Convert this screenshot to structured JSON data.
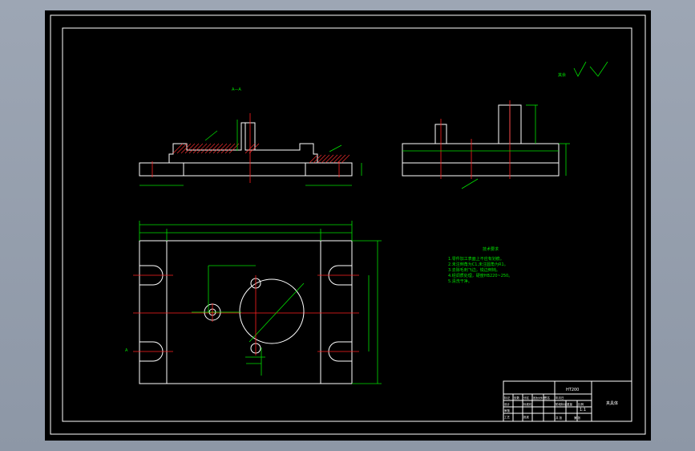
{
  "drawing": {
    "section_label": "A—A",
    "section_marker": "A",
    "roughness_note": "其余",
    "colors": {
      "background": "#000000",
      "outline": "#ffffff",
      "dimension": "#00e000",
      "centerline": "#ff2020",
      "viewport_frame": "#8d97a6"
    }
  },
  "tech_requirements": {
    "title": "技术要求",
    "items": [
      "1.零件加工表面上不应有划痕。",
      "2.未注倒角为C1,未注圆角为R1。",
      "3.去除毛刺飞边，锐边倒钝。",
      "4.经调质处理，硬度HB220~250。",
      "5.清洗干净。"
    ]
  },
  "title_block": {
    "material": "HT200",
    "part_name": "夹具体",
    "scale": "1:1",
    "labels": [
      "标记",
      "处数",
      "分区",
      "更改文件号",
      "签名",
      "年月日",
      "设计",
      "标准化",
      "审核",
      "工艺",
      "批准",
      "阶段标记",
      "重量",
      "比例",
      "共 张",
      "第 张"
    ]
  }
}
